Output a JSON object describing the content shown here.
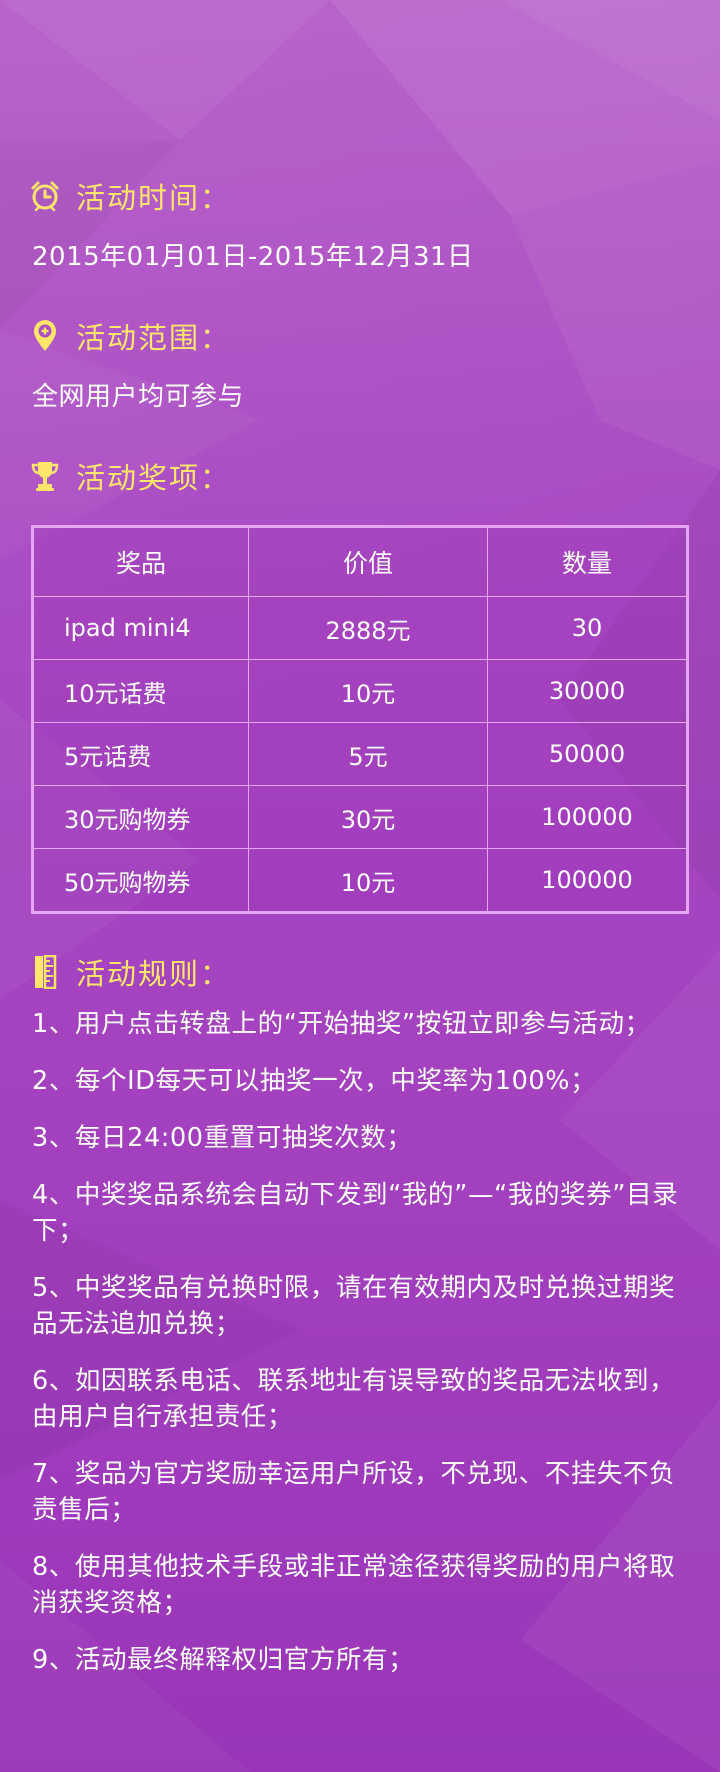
{
  "time_section": {
    "title": "活动时间：",
    "icon": "alarm-clock-icon",
    "value": "2015年01月01日-2015年12月31日"
  },
  "scope_section": {
    "title": "活动范围：",
    "icon": "location-pin-icon",
    "value": "全网用户均可参与"
  },
  "prize_section": {
    "title": "活动奖项：",
    "icon": "trophy-icon",
    "headers": [
      "奖品",
      "价值",
      "数量"
    ],
    "rows": [
      [
        "ipad mini4",
        "2888元",
        "30"
      ],
      [
        "10元话费",
        "10元",
        "30000"
      ],
      [
        "5元话费",
        "5元",
        "50000"
      ],
      [
        "30元购物券",
        "30元",
        "100000"
      ],
      [
        "50元购物券",
        "10元",
        "100000"
      ]
    ]
  },
  "rules_section": {
    "title": "活动规则：",
    "icon": "ruler-icon",
    "items": [
      "1、用户点击转盘上的“开始抽奖”按钮立即参与活动；",
      "2、每个ID每天可以抽奖一次，中奖率为100%；",
      "3、每日24:00重置可抽奖次数；",
      "4、中奖奖品系统会自动下发到“我的”—“我的奖券”目录下；",
      "5、中奖奖品有兑换时限，请在有效期内及时兑换过期奖品无法追加兑换；",
      "6、如因联系电话、联系地址有误导致的奖品无法收到，由用户自行承担责任；",
      "7、奖品为官方奖励幸运用户所设，不兑现、不挂失不负责售后；",
      "8、使用其他技术手段或非正常途径获得奖励的用户将取消获奖资格；",
      "9、活动最终解释权归官方所有；"
    ]
  },
  "colors": {
    "background": "#a848c2",
    "heading": "#ffe66b",
    "table_border": "#e7a6f3",
    "text": "#ffffff"
  }
}
